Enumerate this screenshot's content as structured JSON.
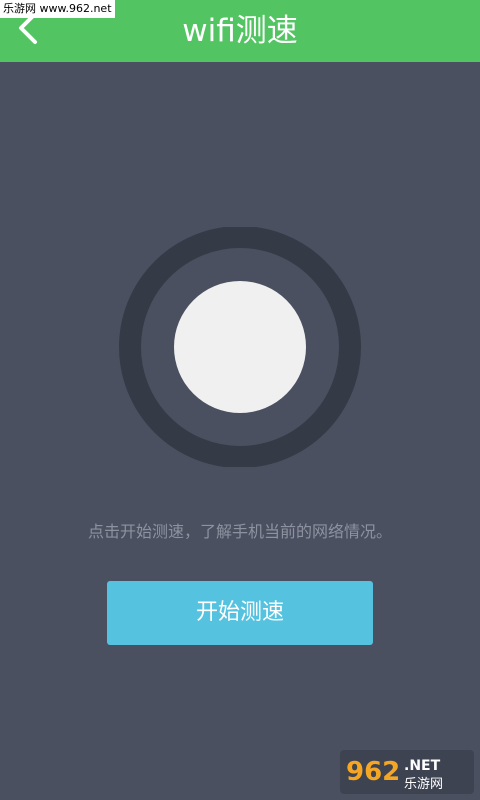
{
  "header": {
    "title": "wifi测速",
    "back_icon": "chevron-left-icon",
    "background": "#52C462"
  },
  "watermark": {
    "top_text": "乐游网 www.962.net",
    "logo_number": "962",
    "logo_suffix": ".NET",
    "logo_cn": "乐游网"
  },
  "gauge": {
    "ring_color": "#353A47",
    "center_color": "#F0F0F0"
  },
  "main": {
    "hint": "点击开始测速，了解手机当前的网络情况。",
    "start_button": "开始测速",
    "button_color": "#55C3DF"
  },
  "colors": {
    "background": "#4B5061"
  }
}
